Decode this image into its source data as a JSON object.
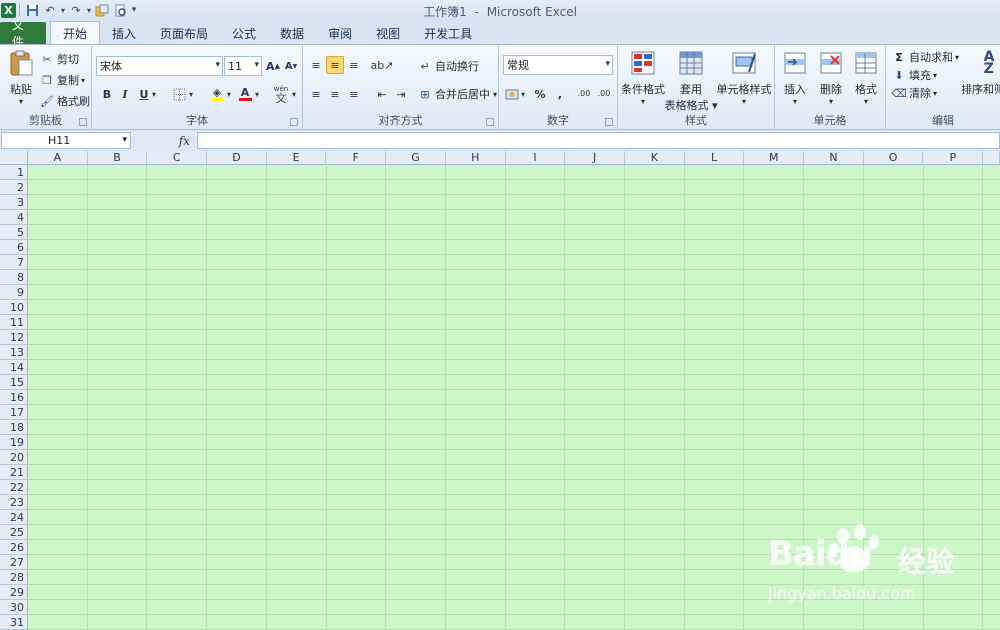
{
  "window": {
    "title": "工作簿1",
    "separator": "-",
    "app": "Microsoft Excel"
  },
  "tabs": [
    {
      "label": "文件"
    },
    {
      "label": "开始"
    },
    {
      "label": "插入"
    },
    {
      "label": "页面布局"
    },
    {
      "label": "公式"
    },
    {
      "label": "数据"
    },
    {
      "label": "审阅"
    },
    {
      "label": "视图"
    },
    {
      "label": "开发工具"
    }
  ],
  "ribbon": {
    "clipboard": {
      "label": "剪贴板",
      "paste": "粘贴",
      "cut": "剪切",
      "copy": "复制",
      "format_painter": "格式刷"
    },
    "font": {
      "label": "字体",
      "font_name": "宋体",
      "font_size": "11",
      "grow": "A",
      "shrink": "A",
      "bold": "B",
      "italic": "I",
      "underline": "U",
      "font_color": "A",
      "wen": "wén",
      "wen_char": "文"
    },
    "alignment": {
      "label": "对齐方式",
      "wrap_text": "自动换行",
      "merge_center": "合并后居中"
    },
    "number": {
      "label": "数字",
      "format": "常规",
      "percent": "%",
      "comma": ",",
      "inc_decimal": ".00",
      "dec_decimal": ".00"
    },
    "styles": {
      "label": "样式",
      "conditional": "条件格式",
      "format_table_1": "套用",
      "format_table_2": "表格格式",
      "cell_styles": "单元格样式"
    },
    "cells": {
      "label": "单元格",
      "insert": "插入",
      "delete": "删除",
      "format": "格式"
    },
    "editing": {
      "label": "编辑",
      "autosum": "自动求和",
      "fill": "填充",
      "clear": "清除",
      "sort_filter": "排序和筛"
    }
  },
  "formula_bar": {
    "name_box": "H11",
    "fx": "fx",
    "content": ""
  },
  "sheet": {
    "columns": [
      "A",
      "B",
      "C",
      "D",
      "E",
      "F",
      "G",
      "H",
      "I",
      "J",
      "K",
      "L",
      "M",
      "N",
      "O",
      "P"
    ],
    "rows": [
      "1",
      "2",
      "3",
      "4",
      "5",
      "6",
      "7",
      "8",
      "9",
      "10",
      "11",
      "12",
      "13",
      "14",
      "15",
      "16",
      "17",
      "18",
      "19",
      "20",
      "21",
      "22",
      "23",
      "24",
      "25",
      "26",
      "27",
      "28",
      "29",
      "30",
      "31"
    ],
    "background": "#cdf7c8"
  },
  "watermark": {
    "brand": "Baidu",
    "cn": "经验",
    "url": "jingyan.baidu.com"
  },
  "colors": {
    "file_tab": "#2f7a3a",
    "grid_bg": "#cdf7c8",
    "ribbon_bg": "#f6f9fd"
  }
}
